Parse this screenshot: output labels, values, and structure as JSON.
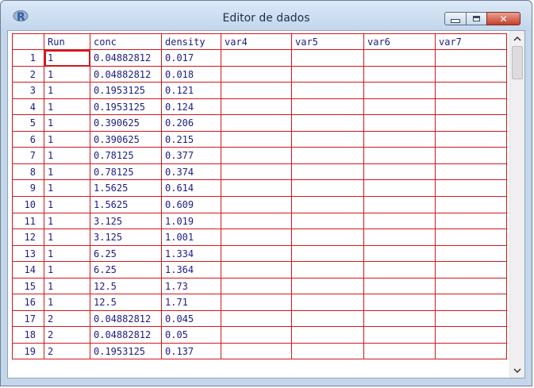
{
  "window": {
    "title": "Editor de dados",
    "app_icon": "r-logo-icon",
    "controls": {
      "minimize": "minimize-icon",
      "maximize": "maximize-icon",
      "close_glyph": "✕"
    }
  },
  "columns": [
    "Run",
    "conc",
    "density",
    "var4",
    "var5",
    "var6",
    "var7"
  ],
  "rows": [
    {
      "n": "1",
      "cells": [
        "1",
        "0.04882812",
        "0.017",
        "",
        "",
        "",
        ""
      ]
    },
    {
      "n": "2",
      "cells": [
        "1",
        "0.04882812",
        "0.018",
        "",
        "",
        "",
        ""
      ]
    },
    {
      "n": "3",
      "cells": [
        "1",
        "0.1953125",
        "0.121",
        "",
        "",
        "",
        ""
      ]
    },
    {
      "n": "4",
      "cells": [
        "1",
        "0.1953125",
        "0.124",
        "",
        "",
        "",
        ""
      ]
    },
    {
      "n": "5",
      "cells": [
        "1",
        "0.390625",
        "0.206",
        "",
        "",
        "",
        ""
      ]
    },
    {
      "n": "6",
      "cells": [
        "1",
        "0.390625",
        "0.215",
        "",
        "",
        "",
        ""
      ]
    },
    {
      "n": "7",
      "cells": [
        "1",
        "0.78125",
        "0.377",
        "",
        "",
        "",
        ""
      ]
    },
    {
      "n": "8",
      "cells": [
        "1",
        "0.78125",
        "0.374",
        "",
        "",
        "",
        ""
      ]
    },
    {
      "n": "9",
      "cells": [
        "1",
        "1.5625",
        "0.614",
        "",
        "",
        "",
        ""
      ]
    },
    {
      "n": "10",
      "cells": [
        "1",
        "1.5625",
        "0.609",
        "",
        "",
        "",
        ""
      ]
    },
    {
      "n": "11",
      "cells": [
        "1",
        "3.125",
        "1.019",
        "",
        "",
        "",
        ""
      ]
    },
    {
      "n": "12",
      "cells": [
        "1",
        "3.125",
        "1.001",
        "",
        "",
        "",
        ""
      ]
    },
    {
      "n": "13",
      "cells": [
        "1",
        "6.25",
        "1.334",
        "",
        "",
        "",
        ""
      ]
    },
    {
      "n": "14",
      "cells": [
        "1",
        "6.25",
        "1.364",
        "",
        "",
        "",
        ""
      ]
    },
    {
      "n": "15",
      "cells": [
        "1",
        "12.5",
        "1.73",
        "",
        "",
        "",
        ""
      ]
    },
    {
      "n": "16",
      "cells": [
        "1",
        "12.5",
        "1.71",
        "",
        "",
        "",
        ""
      ]
    },
    {
      "n": "17",
      "cells": [
        "2",
        "0.04882812",
        "0.045",
        "",
        "",
        "",
        ""
      ]
    },
    {
      "n": "18",
      "cells": [
        "2",
        "0.04882812",
        "0.05",
        "",
        "",
        "",
        ""
      ]
    },
    {
      "n": "19",
      "cells": [
        "2",
        "0.1953125",
        "0.137",
        "",
        "",
        "",
        ""
      ]
    }
  ],
  "active_cell": {
    "row": 1,
    "column": "Run"
  },
  "scrollbar": {
    "up": "▲",
    "down": "▼"
  },
  "colors": {
    "grid_line": "#d2181e",
    "cell_text": "#1c1c8a",
    "title_bar": "#c3d7ed"
  }
}
